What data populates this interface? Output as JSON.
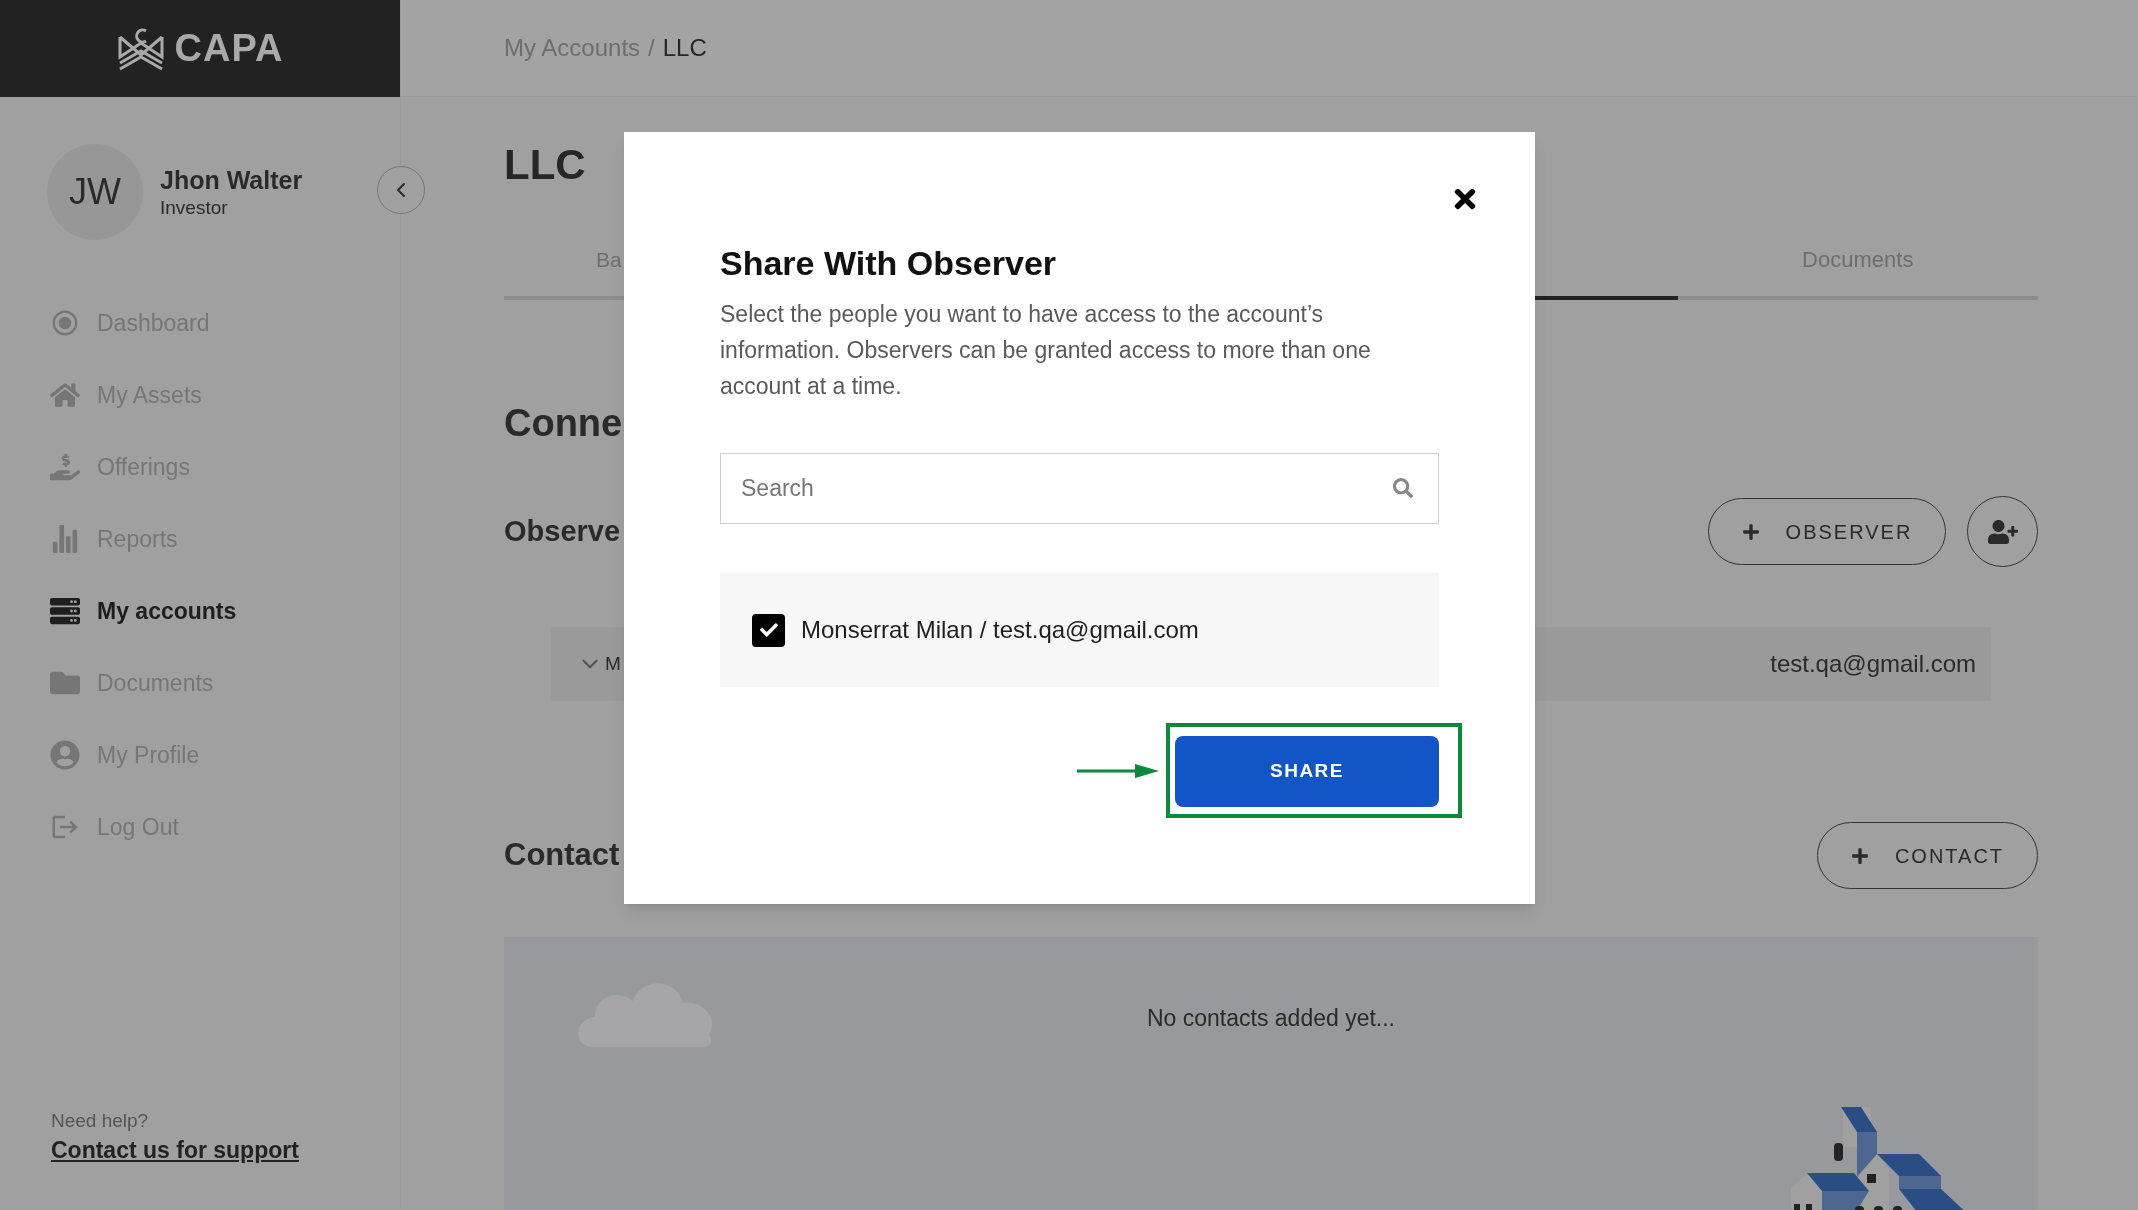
{
  "brand": {
    "name": "CAPA"
  },
  "breadcrumb": {
    "separator": "/",
    "items": [
      {
        "label": "My Accounts",
        "current": false
      },
      {
        "label": "LLC",
        "current": true
      }
    ]
  },
  "user": {
    "initials": "JW",
    "name": "Jhon Walter",
    "role": "Investor"
  },
  "sidebar": {
    "items": [
      {
        "label": "Dashboard",
        "selected": false
      },
      {
        "label": "My Assets",
        "selected": false
      },
      {
        "label": "Offerings",
        "selected": false
      },
      {
        "label": "Reports",
        "selected": false
      },
      {
        "label": "My accounts",
        "selected": true
      },
      {
        "label": "Documents",
        "selected": false
      },
      {
        "label": "My Profile",
        "selected": false
      },
      {
        "label": "Log Out",
        "selected": false
      }
    ],
    "help": "Need help?",
    "support_link": "Contact us for support"
  },
  "page": {
    "title": "LLC",
    "tabs": [
      {
        "label": "Ba",
        "selected": false
      },
      {
        "selected": true
      },
      {
        "label": "Documents",
        "selected": false
      }
    ],
    "connected_heading": "Conne",
    "observers": {
      "heading": "Observe",
      "add_button": "OBSERVER",
      "rows": [
        {
          "name": "M",
          "email": "test.qa@gmail.com",
          "expanded": false
        }
      ]
    },
    "contacts": {
      "heading": "Contact",
      "add_button": "CONTACT",
      "empty_text": "No contacts added yet..."
    }
  },
  "modal": {
    "title": "Share With Observer",
    "description": "Select the people you want to have access to the account’s information. Observers can be granted access to more than one account at a time.",
    "search": {
      "placeholder": "Search"
    },
    "options": [
      {
        "label": "Monserrat Milan / test.qa@gmail.com",
        "checked": true
      }
    ],
    "share_button": "SHARE"
  }
}
